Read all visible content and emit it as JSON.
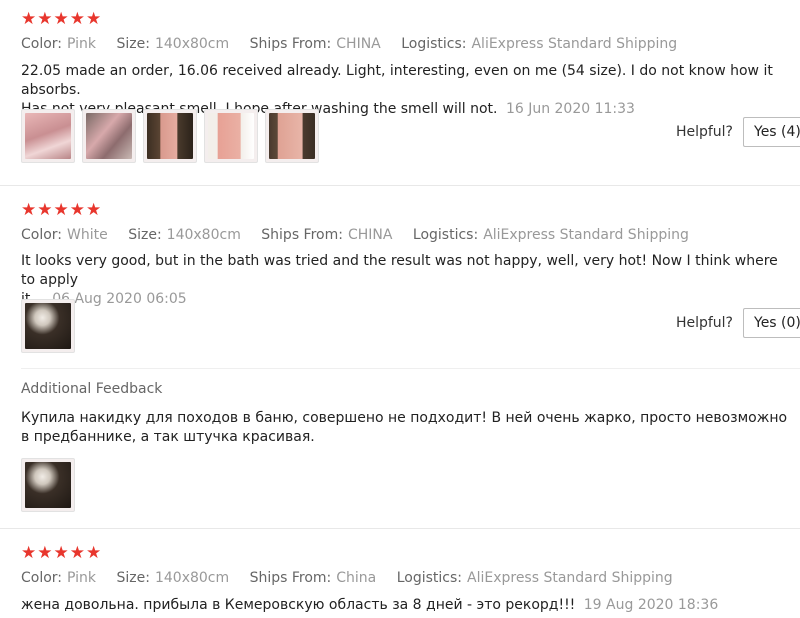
{
  "reviews": [
    {
      "stars": "★★★★★",
      "color_label": "Color:",
      "color": "Pink",
      "size_label": "Size:",
      "size": "140x80cm",
      "ships_label": "Ships From:",
      "ships": "CHINA",
      "logistics_label": "Logistics:",
      "logistics": "AliExpress Standard Shipping",
      "text_line1": "22.05 made an order, 16.06 received already. Light, interesting, even on me (54 size). I do not know how it absorbs.",
      "text_line2": "Has not very pleasant smell, I hope after washing the smell will not.",
      "date": "16 Jun 2020 11:33",
      "helpful_label": "Helpful?",
      "yes_button": "Yes (4)"
    },
    {
      "stars": "★★★★★",
      "color_label": "Color:",
      "color": "White",
      "size_label": "Size:",
      "size": "140x80cm",
      "ships_label": "Ships From:",
      "ships": "CHINA",
      "logistics_label": "Logistics:",
      "logistics": "AliExpress Standard Shipping",
      "text_line1": "It looks very good, but in the bath was tried and the result was not happy, well, very hot! Now I think where to apply",
      "text_line2": "it...",
      "date": "06 Aug 2020 06:05",
      "helpful_label": "Helpful?",
      "yes_button": "Yes (0)",
      "additional_title": "Additional Feedback",
      "additional_line1": "Купила накидку для походов в баню, совершено не подходит! В ней очень жарко, просто невозможно",
      "additional_line2": "в предбаннике, а так штучка красивая."
    },
    {
      "stars": "★★★★★",
      "color_label": "Color:",
      "color": "Pink",
      "size_label": "Size:",
      "size": "140x80cm",
      "ships_label": "Ships From:",
      "ships": "China",
      "logistics_label": "Logistics:",
      "logistics": "AliExpress Standard Shipping",
      "text_line1": "жена довольна. прибыла в Кемеровскую область за 8 дней - это рекорд!!!",
      "date": "19 Aug 2020 18:36"
    }
  ],
  "colors": {
    "star": "#e8362d",
    "meta_key": "#666666",
    "meta_value": "#999999"
  }
}
